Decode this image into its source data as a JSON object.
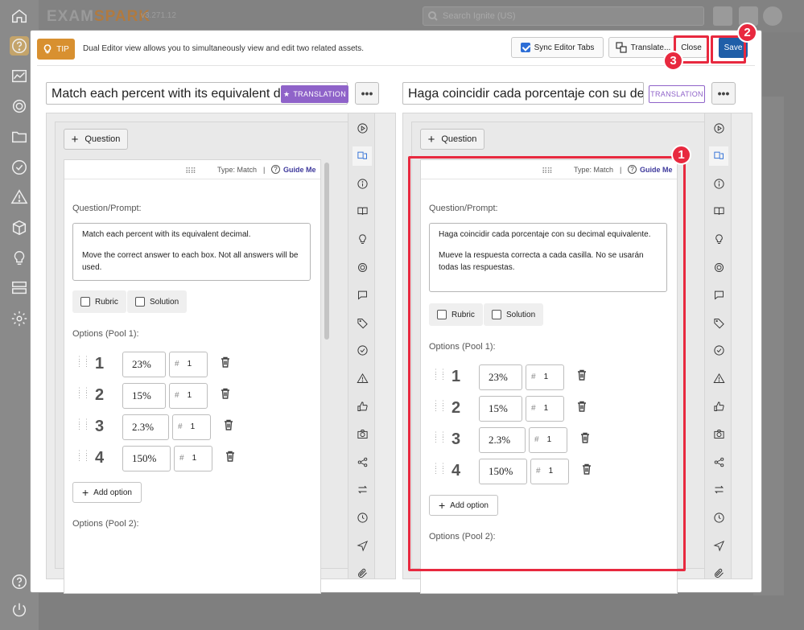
{
  "app": {
    "logo_a": "EXAM",
    "logo_b": "SPARK",
    "version": "v3.271.12",
    "search_placeholder": "Search Ignite (US)"
  },
  "sidebar": {
    "icons": [
      "home-icon",
      "help-icon",
      "chart-icon",
      "target-icon",
      "folder-icon",
      "check-circle-icon",
      "warning-icon",
      "cube-icon",
      "bulb-icon",
      "server-icon",
      "gear-icon",
      "help-icon",
      "power-icon"
    ]
  },
  "modal": {
    "tip_label": "TIP",
    "tip_text": "Dual Editor view allows you to simultaneously view and edit two related assets.",
    "sync_label": "Sync Editor Tabs",
    "sync_checked": true,
    "translate_label": "Translate...",
    "close_label": "Close",
    "save_label": "Save",
    "annotations": [
      "1",
      "2",
      "3"
    ],
    "highlight_color": "#e8293f"
  },
  "left": {
    "title": "Match each percent with its equivalent decimal",
    "badge": "TRANSLATION",
    "more": "•••",
    "question_btn": "Question",
    "drag": "⠿⠿",
    "type_label": "Type: Match",
    "sep": "|",
    "guide": "Guide Me",
    "prompt_label": "Question/Prompt:",
    "prompt_lines": [
      "Match each percent with its equivalent decimal.",
      "Move the correct answer to each box. Not all answers will be used."
    ],
    "rubric": "Rubric",
    "solution": "Solution",
    "pool1_label": "Options (Pool 1):",
    "options": [
      {
        "num": "1",
        "value": "23%",
        "id": "1"
      },
      {
        "num": "2",
        "value": "15%",
        "id": "1"
      },
      {
        "num": "3",
        "value": "2.3%",
        "id": "1"
      },
      {
        "num": "4",
        "value": "150%",
        "id": "1"
      }
    ],
    "add_option": "Add option",
    "pool2_label": "Options (Pool 2):"
  },
  "right": {
    "title": "Haga coincidir cada porcentaje con su decimal",
    "badge": "TRANSLATION",
    "more": "•••",
    "question_btn": "Question",
    "drag": "⠿⠿",
    "type_label": "Type: Match",
    "sep": "|",
    "guide": "Guide Me",
    "prompt_label": "Question/Prompt:",
    "prompt_lines": [
      "Haga coincidir cada porcentaje con su decimal equivalente.",
      "Mueve la respuesta correcta a cada casilla. No se usarán todas las respuestas."
    ],
    "rubric": "Rubric",
    "solution": "Solution",
    "pool1_label": "Options (Pool 1):",
    "options": [
      {
        "num": "1",
        "value": "23%",
        "id": "1"
      },
      {
        "num": "2",
        "value": "15%",
        "id": "1"
      },
      {
        "num": "3",
        "value": "2.3%",
        "id": "1"
      },
      {
        "num": "4",
        "value": "150%",
        "id": "1"
      }
    ],
    "add_option": "Add option",
    "pool2_label": "Options (Pool 2):"
  },
  "rail_icons": [
    "play-icon",
    "translate-icon",
    "info-icon",
    "book-icon",
    "bulb-icon",
    "target-icon",
    "comment-icon",
    "tag-icon",
    "check-circle-icon",
    "warning-icon",
    "thumbs-up-icon",
    "camera-icon",
    "share-icon",
    "swap-icon",
    "clock-icon",
    "send-icon",
    "paperclip-icon"
  ]
}
